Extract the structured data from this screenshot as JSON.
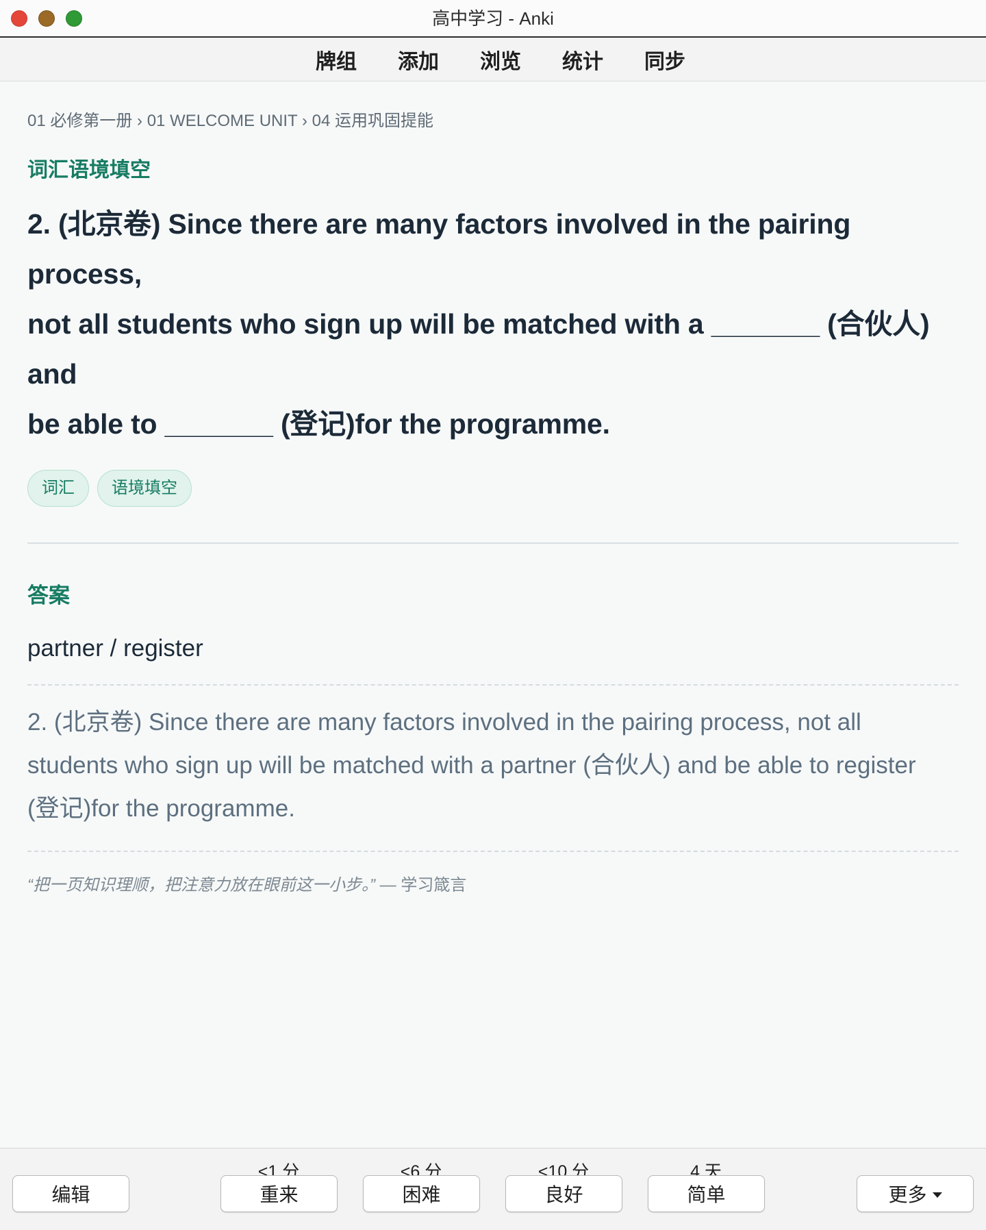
{
  "window": {
    "title": "高中学习 - Anki"
  },
  "toolbar": {
    "items": [
      "牌组",
      "添加",
      "浏览",
      "统计",
      "同步"
    ]
  },
  "card": {
    "breadcrumb": "01 必修第一册 › 01 WELCOME UNIT › 04 运用巩固提能",
    "section": "词汇语境填空",
    "question_line1": "2.  (北京卷) Since there are many factors involved in the pairing process,",
    "question_line2": "not all students who sign up will be matched with a _______ (合伙人) and",
    "question_line3": "be able to _______ (登记)for the programme.",
    "tags": [
      "词汇",
      "语境填空"
    ],
    "answer_label": "答案",
    "answer": "partner / register",
    "full_line1": "2.  (北京卷) Since there are many factors involved in the pairing process, not all",
    "full_line2": "students who sign up will be matched with a partner (合伙人) and be able to register",
    "full_line3": "(登记)for the programme.",
    "quote": "“把一页知识理顺，把注意力放在眼前这一小步。”",
    "quote_source": "— 学习箴言"
  },
  "bottom": {
    "edit": "编辑",
    "more": "更多",
    "answers": [
      {
        "timing": "<1 分",
        "label": "重来"
      },
      {
        "timing": "<6 分",
        "label": "困难"
      },
      {
        "timing": "<10 分",
        "label": "良好"
      },
      {
        "timing": "4 天",
        "label": "简单"
      }
    ]
  }
}
